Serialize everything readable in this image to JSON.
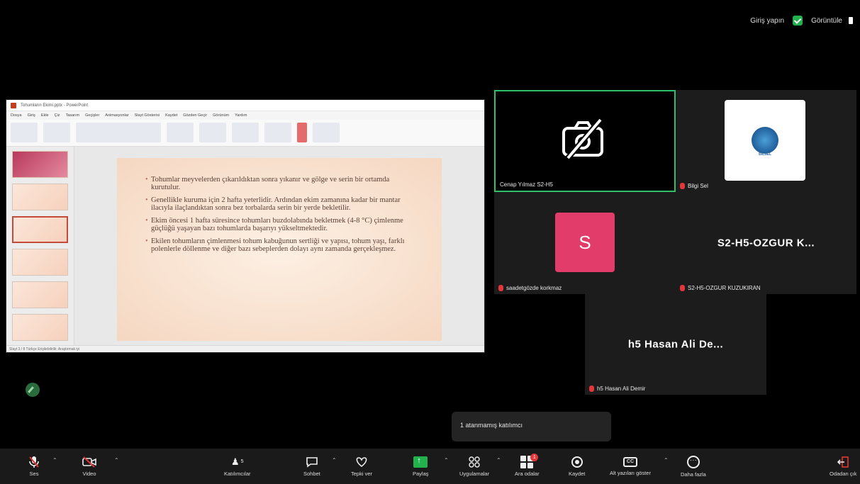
{
  "topbar": {
    "signin": "Giriş yapın",
    "view": "Görüntüle"
  },
  "share": {
    "title": "Tohumların Ekimi.pptx - PowerPoint",
    "tabs": [
      "Dosya",
      "Giriş",
      "Ekle",
      "Çiz",
      "Tasarım",
      "Geçişler",
      "Animasyonlar",
      "Slayt Gösterisi",
      "Kaydet",
      "Gözden Geçir",
      "Görünüm",
      "Yardım"
    ],
    "status": "Slayt 3 / 8   Türkçe   Erişilebilirlik: Araştırmak iyi",
    "bullets": [
      "Tohumlar meyvelerden çıkarıldıktan sonra yıkanır ve gölge ve serin bir ortamda kurutulur.",
      "Genellikle kuruma için 2 hafta yeterlidir. Ardından ekim zamanına kadar bir mantar ilacıyla ilaçlandıktan sonra bez torbalarda serin bir yerde bekletilir.",
      "Ekim öncesi 1 hafta süresince tohumları buzdolabında bekletmek (4-8 °C) çimlenme güçlüğü yaşayan bazı tohumlarda başarıyı yükseltmektedir.",
      "Ekilen tohumların çimlenmesi tohum kabuğunun sertliği ve yapısı, tohum yaşı, farklı polenlerle döllenme ve diğer bazı sebeplerden dolayı aynı zamanda gerçekleşmez."
    ]
  },
  "participants": [
    {
      "name": "Cenap Yılmaz S2-H5",
      "muted": false
    },
    {
      "name": "Bilgi Sel",
      "muted": true,
      "logo_text": "BİLSEL"
    },
    {
      "name": "saadetgözde korkmaz",
      "muted": true,
      "avatar": "S",
      "avatar_color": "#e23c6a"
    },
    {
      "name": "S2-H5-OZGUR KUZUKIRAN",
      "muted": true,
      "display": "S2-H5-OZGUR K..."
    },
    {
      "name": "h5 Hasan Ali Demir",
      "muted": true,
      "display": "h5 Hasan Ali De..."
    }
  ],
  "toast": "1 atanmamış katılımcı",
  "toolbar": {
    "audio": "Ses",
    "video": "Video",
    "participants": "Katılımcılar",
    "participants_count": "5",
    "chat": "Sohbet",
    "react": "Tepki ver",
    "share": "Paylaş",
    "apps": "Uygulamalar",
    "breakout": "Ara odalar",
    "breakout_badge": "1",
    "record": "Kaydet",
    "captions": "Alt yazıları göster",
    "more": "Daha fazla",
    "leave": "Odadan çık"
  },
  "colors": {
    "accent_green": "#23b14d",
    "mute_red": "#e2373a",
    "speaker_border": "#2fc16a"
  }
}
